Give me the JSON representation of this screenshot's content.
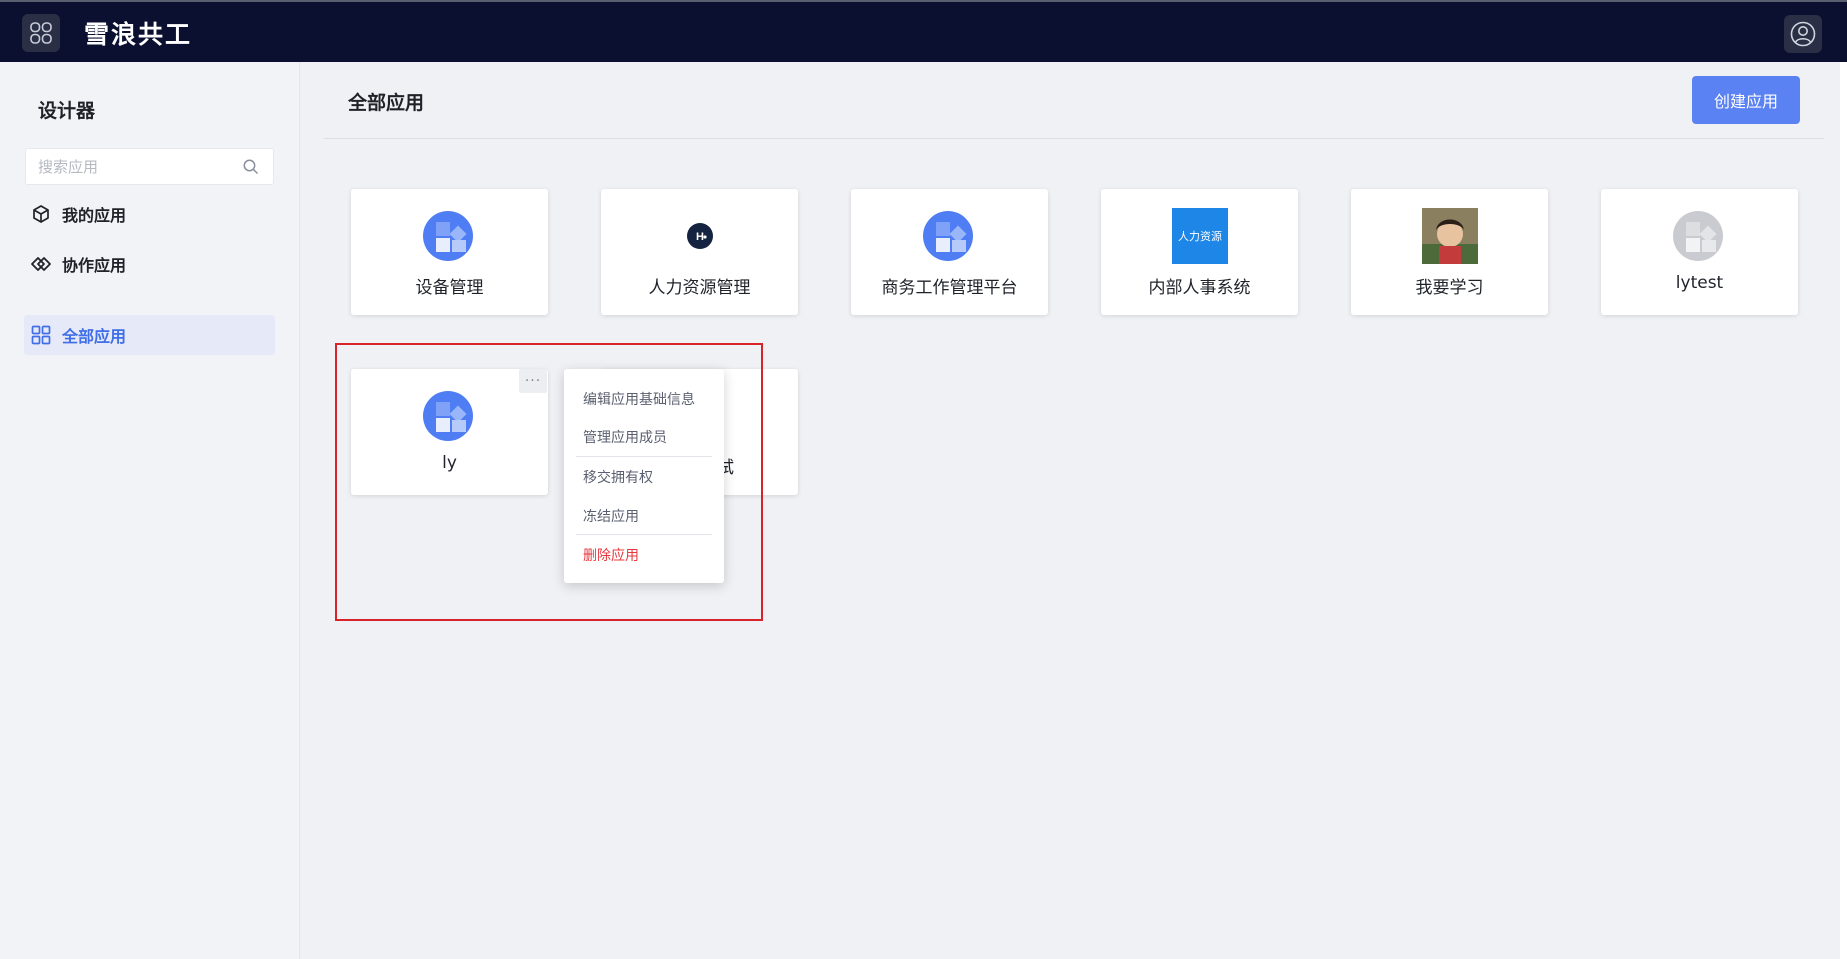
{
  "header": {
    "brand": "雪浪共工",
    "app_switch_icon": "grid-icon",
    "avatar_icon": "user-icon"
  },
  "sidebar": {
    "title": "设计器",
    "search_placeholder": "搜索应用",
    "items": [
      {
        "label": "我的应用",
        "icon": "cube-icon",
        "active": false
      },
      {
        "label": "协作应用",
        "icon": "collab-icon",
        "active": true
      },
      {
        "label": "全部应用",
        "icon": "grid-icon",
        "active": true
      }
    ]
  },
  "main": {
    "title": "全部应用",
    "create_label": "创建应用",
    "apps": [
      {
        "name": "设备管理",
        "logo": "default-app-logo"
      },
      {
        "name": "人力资源管理",
        "logo": "hr-logo"
      },
      {
        "name": "商务工作管理平台",
        "logo": "default-app-logo"
      },
      {
        "name": "内部人事系统",
        "logo": "hr-banner-logo",
        "logo_text": "人力资源"
      },
      {
        "name": "我要学习",
        "logo": "photo-logo"
      },
      {
        "name": "lytest",
        "logo": "default-app-logo-gray"
      },
      {
        "name": "ly",
        "logo": "default-app-logo"
      },
      {
        "name": "试",
        "logo": "partial-logo"
      }
    ],
    "more_label": "···"
  },
  "context_menu": {
    "items": [
      {
        "label": "编辑应用基础信息",
        "danger": false
      },
      {
        "label": "管理应用成员",
        "danger": false
      },
      {
        "label": "移交拥有权",
        "danger": false
      },
      {
        "label": "冻结应用",
        "danger": false
      },
      {
        "label": "删除应用",
        "danger": true
      }
    ]
  },
  "colors": {
    "topbar": "#0b1030",
    "accent": "#5b82f3",
    "danger": "#e8383d",
    "highlight": "#d9232a"
  }
}
